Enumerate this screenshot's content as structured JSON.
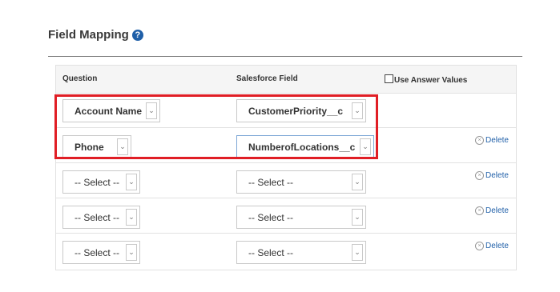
{
  "title": "Field Mapping",
  "help_icon": "question-circle-icon",
  "columns": {
    "question": "Question",
    "salesforce": "Salesforce Field",
    "use_answer_values": "Use Answer Values"
  },
  "rows": [
    {
      "question": "Account Name",
      "salesforce": "CustomerPriority__c",
      "delete": ""
    },
    {
      "question": "Phone",
      "salesforce": "NumberofLocations__c",
      "delete": "Delete"
    },
    {
      "question": "-- Select --",
      "salesforce": "-- Select --",
      "delete": "Delete"
    },
    {
      "question": "-- Select --",
      "salesforce": "-- Select --",
      "delete": "Delete"
    },
    {
      "question": "-- Select --",
      "salesforce": "-- Select --",
      "delete": "Delete"
    }
  ],
  "colors": {
    "accent": "#1f5fa8",
    "highlight": "#e01e25"
  }
}
